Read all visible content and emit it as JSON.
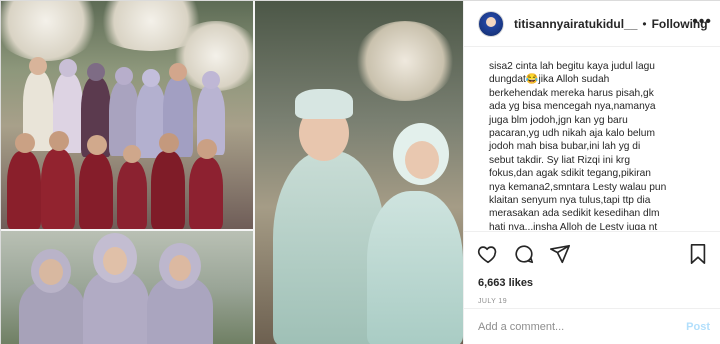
{
  "post": {
    "username": "titisannyairatukidul__",
    "follow_label": "Following",
    "separator": "•",
    "more_label": "•••",
    "caption": "sisa2 cinta lah begitu kaya judul lagu\ndungdat😂jika Alloh sudah\nberkehendak mereka harus pisah,gk\nada yg bisa mencegah nya,namanya\njuga blm jodoh,jgn kan yg baru\npacaran,yg udh nikah aja kalo belum\njodoh mah bisa bubar,ini lah yg di\nsebut takdir. Sy liat Rizqi ini krg\nfokus,dan agak sdikit tegang,pikiran\nnya kemana2,smntara Lesty walau pun\nklaitan senyum nya tulus,tapi ttp dia\nmerasakan ada sedikit kesedihan dlm\nhati nya,,,insha Alloh de Lesty juga nt",
    "likes": "6,663 likes",
    "date": "JULY 19",
    "comment_placeholder": "Add a comment...",
    "post_label": "Post"
  },
  "icons": {
    "like": "heart-icon",
    "comment": "comment-icon",
    "share": "share-icon",
    "save": "bookmark-icon",
    "more": "more-options-icon"
  },
  "colors": {
    "text": "#262626",
    "muted": "#8e8e8e",
    "border": "#efefef",
    "post_disabled": "#b2dffc"
  }
}
